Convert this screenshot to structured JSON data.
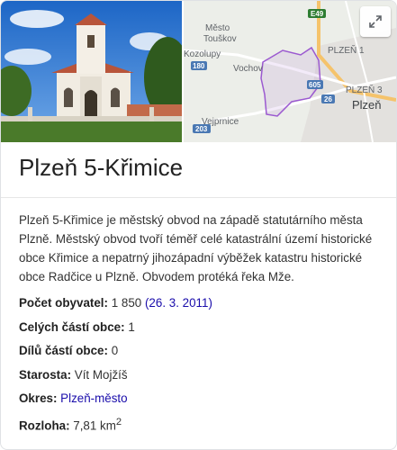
{
  "media": {
    "map_labels": {
      "mesto_touskov": [
        "Město",
        "Touškov"
      ],
      "kozolupy": "Kozolupy",
      "vochov": "Vochov",
      "vejprnice": "Vejprnice",
      "plzen": "Plzeň",
      "plzen1": "PLZEŇ 1",
      "plzen3": "PLZEŇ 3"
    },
    "road_shields": [
      "E49",
      "180",
      "605",
      "26",
      "203"
    ],
    "expand_icon": "expand-arrows-icon"
  },
  "title": "Plzeň 5-Křimice",
  "description": "Plzeň 5-Křimice je městský obvod na západě statutárního města Plzně. Městský obvod tvoří téměř celé katastrální území historické obce Křimice a nepatrný jihozápadní výběžek katastru historické obce Radčice u Plzně. Obvodem protéká řeka Mže.",
  "facts": {
    "population_label": "Počet obyvatel:",
    "population_value": "1 850",
    "population_date": "(26. 3. 2011)",
    "parts_label": "Celých částí obce:",
    "parts_value": "1",
    "pieces_label": "Dílů částí obce:",
    "pieces_value": "0",
    "mayor_label": "Starosta:",
    "mayor_value": "Vít Mojžíš",
    "district_label": "Okres:",
    "district_value": "Plzeň-město",
    "area_label": "Rozloha:",
    "area_value": "7,81 km",
    "area_sup": "2"
  },
  "colors": {
    "link": "#1a0dab",
    "boundary": "#9b59d0",
    "highway": "#f5c36b",
    "shield_green": "#2e7d32",
    "shield_blue": "#4a78b3"
  }
}
